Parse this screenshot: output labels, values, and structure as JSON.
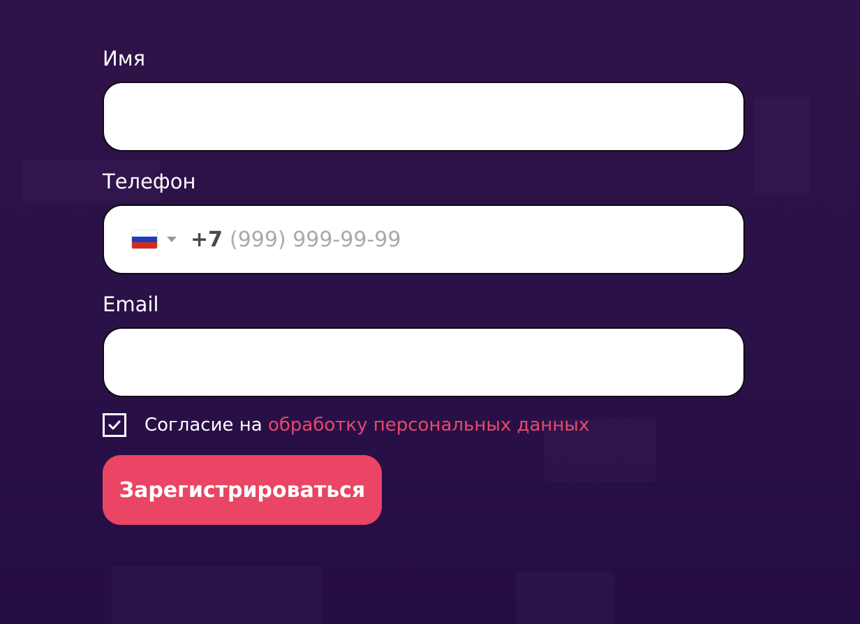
{
  "form": {
    "name_label": "Имя",
    "name_value": "",
    "phone_label": "Телефон",
    "phone_country_code": "+7",
    "phone_placeholder": "(999) 999-99-99",
    "phone_country_flag_icon": "russia-flag-icon",
    "email_label": "Email",
    "email_value": "",
    "consent_checked": true,
    "consent_text": "Согласие на",
    "consent_link": "обработку персональных данных",
    "submit_label": "Зарегистрироваться"
  },
  "colors": {
    "background": "#2c1147",
    "accent": "#ea4564",
    "field_bg": "#ffffff"
  }
}
